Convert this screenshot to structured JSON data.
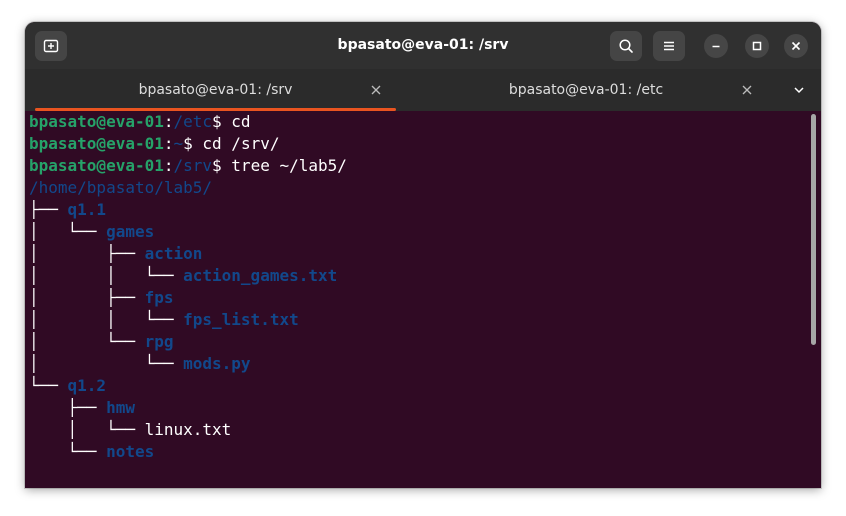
{
  "window": {
    "title": "bpasato@eva-01: /srv"
  },
  "titlebar": {
    "new_tab_icon": "new-tab-icon",
    "search_icon": "search-icon",
    "menu_icon": "hamburger-menu-icon",
    "minimize_icon": "minimize-icon",
    "maximize_icon": "maximize-icon",
    "close_icon": "close-icon"
  },
  "tabs": [
    {
      "label": "bpasato@eva-01: /srv",
      "active": true
    },
    {
      "label": "bpasato@eva-01: /etc",
      "active": false
    }
  ],
  "colors": {
    "accent": "#e95420",
    "terminal_bg": "#300a24",
    "prompt_user": "#26a269",
    "directory": "#12488b"
  },
  "terminal": {
    "prompts": [
      {
        "user": "bpasato@eva-01",
        "colon": ":",
        "path": "/etc",
        "symbol": "$ ",
        "command": "cd"
      },
      {
        "user": "bpasato@eva-01",
        "colon": ":",
        "path": "~",
        "symbol": "$ ",
        "command": "cd /srv/"
      },
      {
        "user": "bpasato@eva-01",
        "colon": ":",
        "path": "/srv",
        "symbol": "$ ",
        "command": "tree ~/lab5/"
      }
    ],
    "tree": [
      {
        "prefix": "",
        "name": "/home/bpasato/lab5/",
        "type": "dir"
      },
      {
        "prefix": "├── ",
        "name": "q1.1",
        "type": "dir"
      },
      {
        "prefix": "│   └── ",
        "name": "games",
        "type": "dir"
      },
      {
        "prefix": "│       ├── ",
        "name": "action",
        "type": "dir"
      },
      {
        "prefix": "│       │   └── ",
        "name": "action_games.txt",
        "type": "dir"
      },
      {
        "prefix": "│       ├── ",
        "name": "fps",
        "type": "dir"
      },
      {
        "prefix": "│       │   └── ",
        "name": "fps_list.txt",
        "type": "dir"
      },
      {
        "prefix": "│       └── ",
        "name": "rpg",
        "type": "dir"
      },
      {
        "prefix": "│           └── ",
        "name": "mods.py",
        "type": "dir"
      },
      {
        "prefix": "└── ",
        "name": "q1.2",
        "type": "dir"
      },
      {
        "prefix": "    ├── ",
        "name": "hmw",
        "type": "dir"
      },
      {
        "prefix": "    │   └── ",
        "name": "linux.txt",
        "type": "file"
      },
      {
        "prefix": "    └── ",
        "name": "notes",
        "type": "dir"
      }
    ]
  }
}
